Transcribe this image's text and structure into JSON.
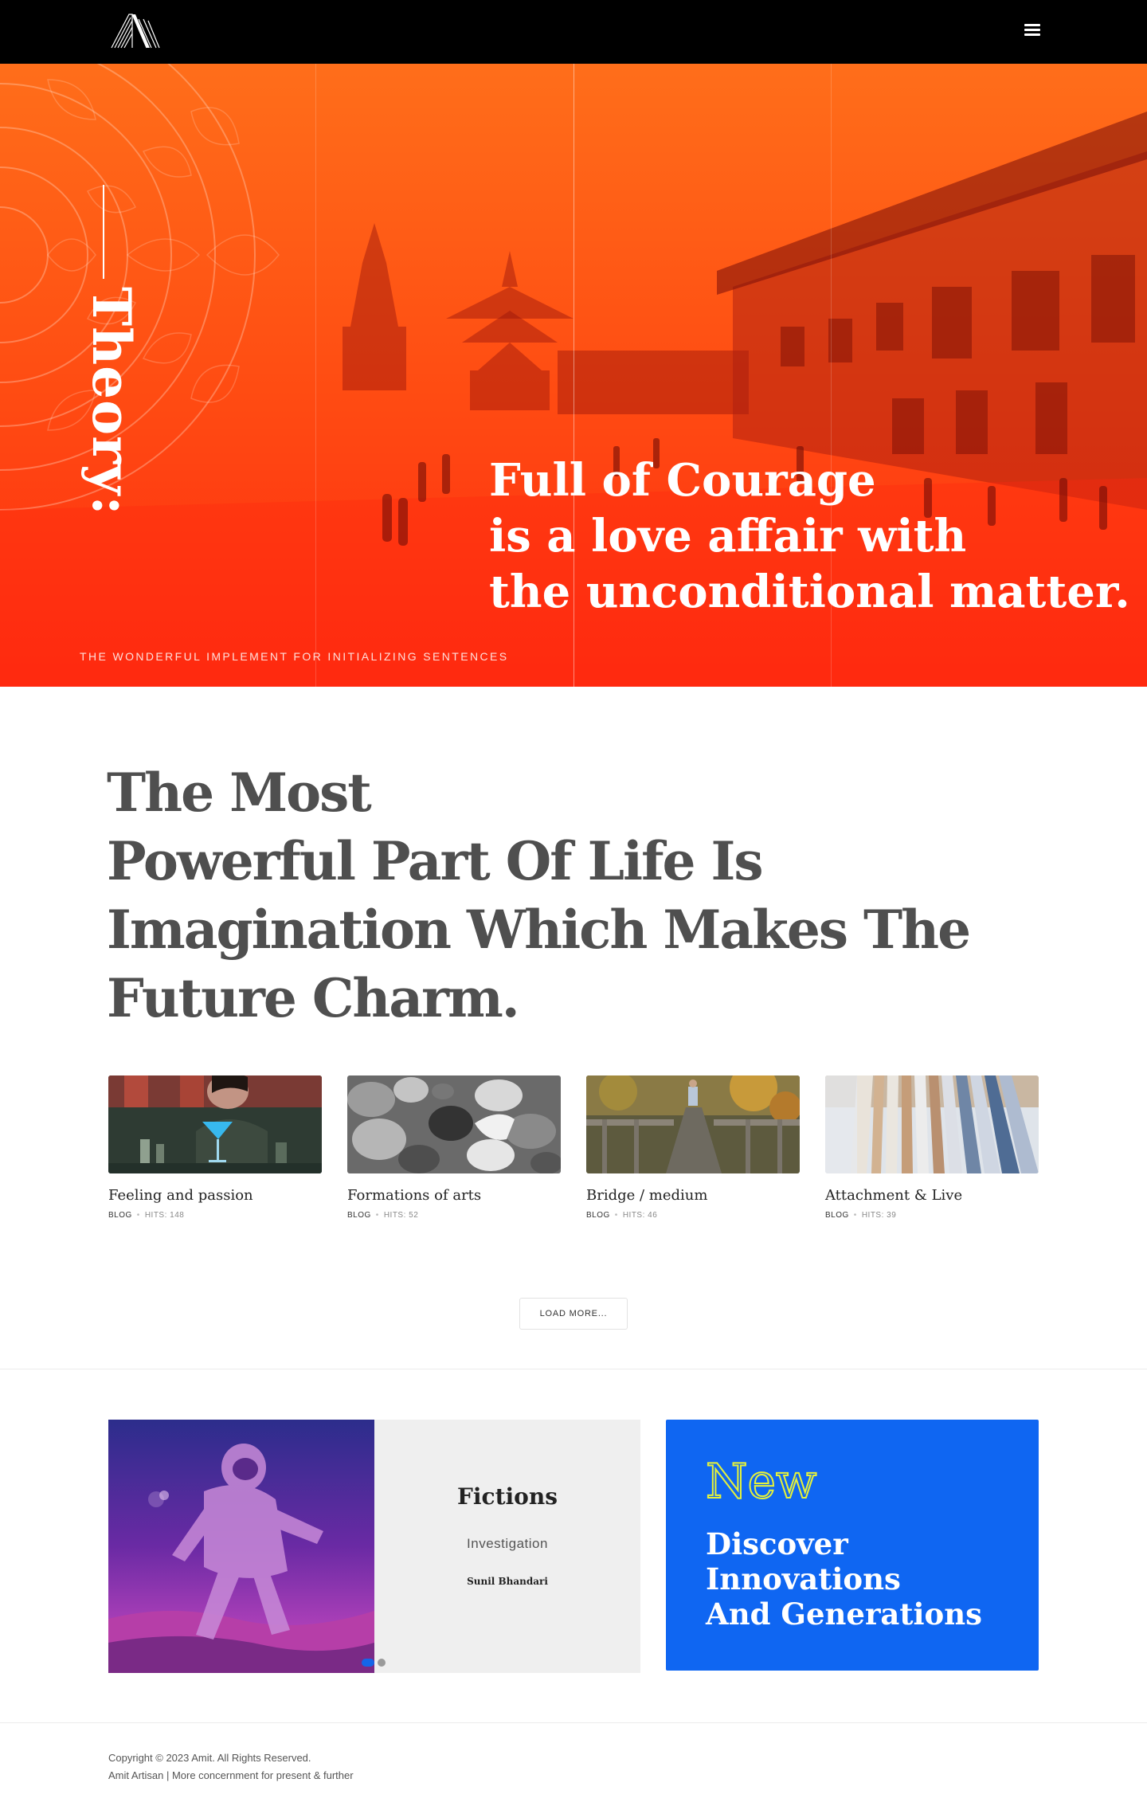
{
  "header": {
    "logo_alt": "A",
    "menu_icon": "hamburger-menu-icon"
  },
  "hero": {
    "vertical_title": "Theory:",
    "quote_lines": [
      "Full of Courage",
      "is a love affair with",
      "the unconditional matter."
    ],
    "caption": "THE WONDERFUL IMPLEMENT FOR INITIALIZING SENTENCES",
    "overlay_color": "#ff3a10"
  },
  "headline": {
    "lines": [
      "The Most",
      "Powerful Part Of Life Is",
      "Imagination Which Makes The",
      "Future Charm."
    ]
  },
  "cards": [
    {
      "title": "Feeling and passion",
      "category": "BLOG",
      "hits": "HITS: 148"
    },
    {
      "title": "Formations of arts",
      "category": "BLOG",
      "hits": "HITS: 52"
    },
    {
      "title": "Bridge / medium",
      "category": "BLOG",
      "hits": "HITS: 46"
    },
    {
      "title": "Attachment & Live",
      "category": "BLOG",
      "hits": "HITS: 39"
    }
  ],
  "load_more_label": "LOAD MORE...",
  "feature": {
    "title": "Fictions",
    "subtitle": "Investigation",
    "author": "Sunil Bhandari",
    "active_slide": 1,
    "slide_count": 2
  },
  "promo": {
    "tag": "New",
    "lines": [
      "Discover",
      "Innovations",
      "And Generations"
    ],
    "bg_color": "#0f66f2",
    "tag_color": "#e5f23a"
  },
  "footer": {
    "copyright": "Copyright © 2023 Amit. All Rights Reserved.",
    "tagline": "Amit Artisan | More concernment for present & further"
  }
}
